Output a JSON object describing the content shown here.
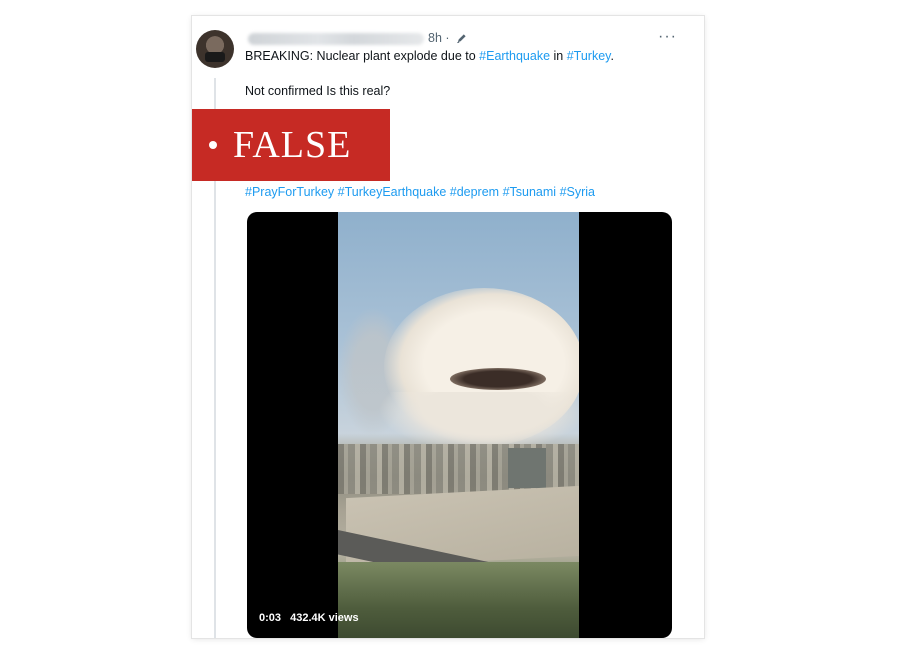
{
  "tweet": {
    "time": "8h ·",
    "text_line1": {
      "prefix": "BREAKING: Nuclear plant explode due to ",
      "tag1": "#Earthquake",
      "middle": " in ",
      "tag2": "#Turkey",
      "suffix": "."
    },
    "text_line2": "Not confirmed Is this real?",
    "hashtags": [
      "#PrayForTurkey",
      "#TurkeyEarthquake",
      "#deprem",
      "#Tsunami",
      "#Syria"
    ],
    "more_label": "···"
  },
  "badge": {
    "label": "FALSE",
    "color": "#c62a24"
  },
  "video": {
    "duration": "0:03",
    "views": "432.4K views"
  },
  "colors": {
    "link": "#1d9bf0",
    "text": "#0f1419",
    "secondary": "#536471"
  },
  "icons": {
    "edit": "pencil-icon",
    "more": "more-horizontal-icon"
  }
}
